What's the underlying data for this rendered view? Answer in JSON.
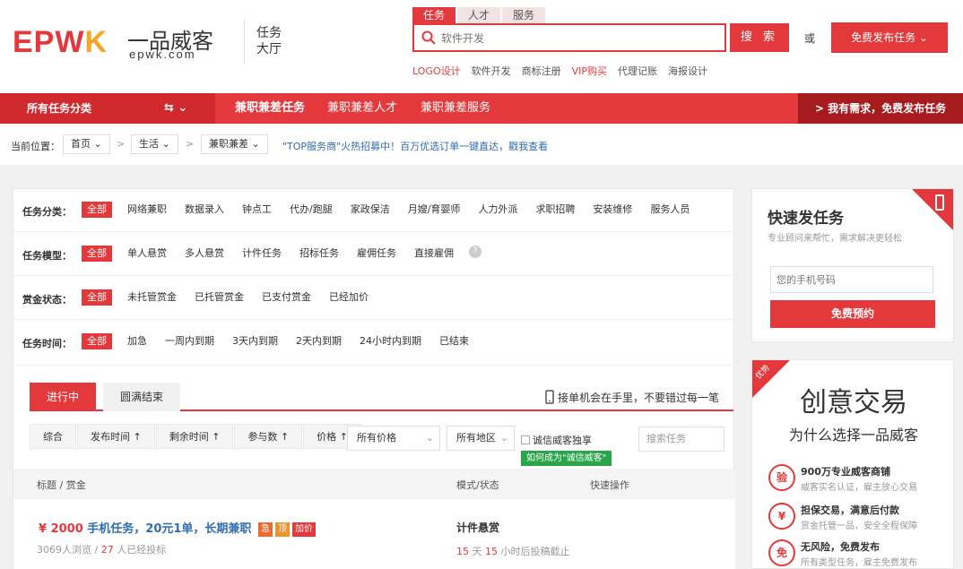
{
  "header": {
    "logo_en": "EPW",
    "logo_k": "K",
    "logo_cn": "一品威客",
    "logo_domain": "epwk.com",
    "hall_label": "任务大厅",
    "search_tabs": [
      "任务",
      "人才",
      "服务"
    ],
    "search_placeholder": "软件开发",
    "search_button": "搜 索",
    "or_text": "或",
    "publish_button": "免费发布任务 ⌄",
    "hot_links": [
      "LOGO设计",
      "软件开发",
      "商标注册",
      "VIP购买",
      "代理记账",
      "海报设计"
    ]
  },
  "nav": {
    "category": "所有任务分类",
    "category_ctrl": "⇆  ⌄",
    "items": [
      "兼职兼差任务",
      "兼职兼差人才",
      "兼职兼差服务"
    ],
    "right": "> 我有需求，免费发布任务"
  },
  "breadcrumb": {
    "label": "当前位置：",
    "crumbs": [
      "首页 ⌄",
      "生活 ⌄",
      "兼职兼差 ⌄"
    ],
    "sep": ">",
    "promo": "\"TOP服务商\"火热招募中！百万优选订单一键直达，戳我查看"
  },
  "filters": [
    {
      "label": "任务分类：",
      "options": [
        "全部",
        "网络兼职",
        "数据录入",
        "钟点工",
        "代办/跑腿",
        "家政保洁",
        "月嫂/育婴师",
        "人力外派",
        "求职招聘",
        "安装维修",
        "服务人员"
      ]
    },
    {
      "label": "任务模型：",
      "options": [
        "全部",
        "单人悬赏",
        "多人悬赏",
        "计件任务",
        "招标任务",
        "雇佣任务",
        "直接雇佣"
      ]
    },
    {
      "label": "赏金状态：",
      "options": [
        "全部",
        "未托管赏金",
        "已托管赏金",
        "已支付赏金",
        "已经加价"
      ]
    },
    {
      "label": "任务时间：",
      "options": [
        "全部",
        "加急",
        "一周内到期",
        "3天内到期",
        "2天内到期",
        "24小时内到期",
        "已结束"
      ]
    }
  ],
  "tabs": {
    "active": "进行中",
    "other": "圆满结束",
    "tip": "接单机会在手里，不要错过每一笔"
  },
  "sort": {
    "items": [
      "综合",
      "发布时间 ↑",
      "剩余时间 ↑",
      "参与数 ↑",
      "价格 ↑"
    ],
    "price_select": "所有价格",
    "region_select": "所有地区",
    "checkbox": "诚信威客独享",
    "green_tip": "如何成为\"诚信威客\"",
    "search_placeholder": "搜索任务"
  },
  "list_header": {
    "title": "标题 / 赏金",
    "mode": "模式/状态",
    "ops": "快速操作"
  },
  "task": {
    "money": "¥ 2000",
    "title": "手机任务，20元1单，长期兼职",
    "tags": [
      "急",
      "顶",
      "加价"
    ],
    "views": "3069人浏览 /",
    "bids": "27",
    "bids_suffix": "人已经投标",
    "mode": "计件悬赏",
    "days": "15",
    "days_u": "天",
    "hours": "15",
    "hours_u": "小时后投稿截止"
  },
  "quick": {
    "title": "快速发任务",
    "subtitle": "专业顾问来帮忙，需求解决更轻松",
    "phone_placeholder": "您的手机号码",
    "button": "免费预约"
  },
  "creative": {
    "ribbon": "优势",
    "title": "创意交易",
    "subtitle": "为什么选择一品威客",
    "features": [
      {
        "icon": "验",
        "title": "900万专业威客商铺",
        "sub": "威客实名认证，雇主放心交易"
      },
      {
        "icon": "¥",
        "title": "担保交易，满意后付款",
        "sub": "赏金托管一品，安全全程保障"
      },
      {
        "icon": "免",
        "title": "无风险，免费发布",
        "sub": "所有类型任务，雇主免费发布"
      }
    ]
  }
}
